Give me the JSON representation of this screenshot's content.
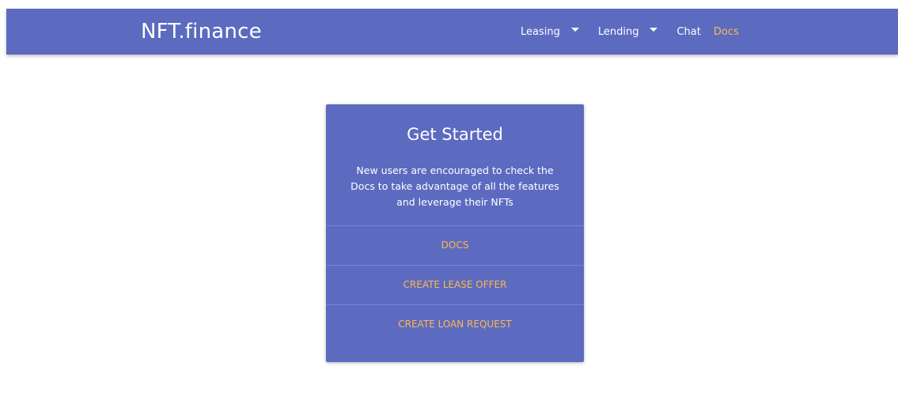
{
  "brand": {
    "title": "NFT.finance"
  },
  "nav": {
    "items": [
      {
        "label": "Leasing",
        "dropdown": true
      },
      {
        "label": "Lending",
        "dropdown": true
      },
      {
        "label": "Chat",
        "dropdown": false
      },
      {
        "label": "Docs",
        "dropdown": false,
        "active": true
      }
    ]
  },
  "card": {
    "title": "Get Started",
    "body": "New users are encouraged to check the Docs to take advantage of all the features and leverage their NFTs",
    "actions": [
      "DOCS",
      "CREATE LEASE OFFER",
      "CREATE LOAN REQUEST"
    ]
  },
  "colors": {
    "primary": "#5c6bc0",
    "accent": "#ffb74d",
    "text": "#ffffff"
  }
}
